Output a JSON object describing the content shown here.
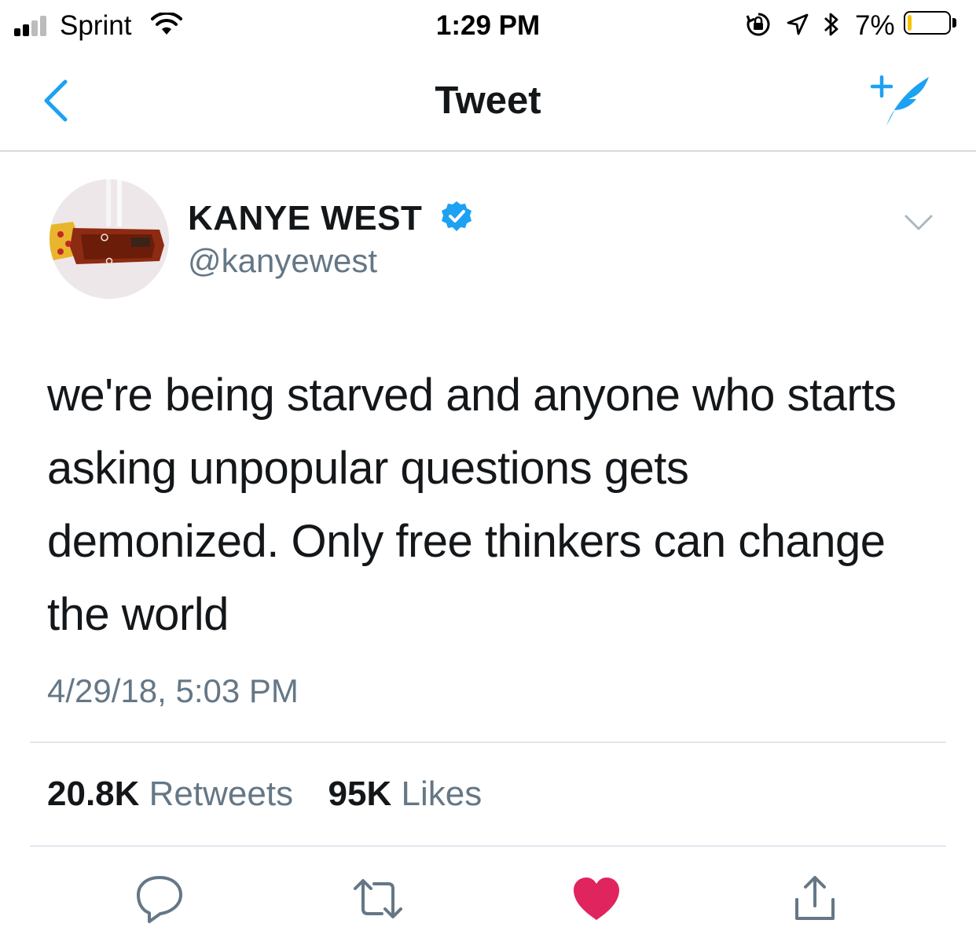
{
  "status_bar": {
    "carrier": "Sprint",
    "time": "1:29 PM",
    "battery_percent": "7%",
    "battery_level": 0.07,
    "battery_color": "#f5c400"
  },
  "nav": {
    "title": "Tweet"
  },
  "tweet": {
    "display_name": "KANYE WEST",
    "handle": "@kanyewest",
    "verified": true,
    "text": "we're being starved and anyone who starts asking unpopular questions gets demonized. Only free thinkers can change the world",
    "timestamp": "4/29/18, 5:03 PM",
    "retweets_count": "20.8K",
    "retweets_label": "Retweets",
    "likes_count": "95K",
    "likes_label": "Likes",
    "liked": true
  },
  "colors": {
    "accent": "#1da1f2",
    "like": "#e0245e",
    "secondary_text": "#657786",
    "icon_gray": "#657786"
  },
  "icons": {
    "back": "chevron-left-icon",
    "compose": "compose-tweet-icon",
    "more": "chevron-down-icon",
    "reply": "reply-icon",
    "retweet": "retweet-icon",
    "like": "heart-icon",
    "share": "share-icon"
  }
}
